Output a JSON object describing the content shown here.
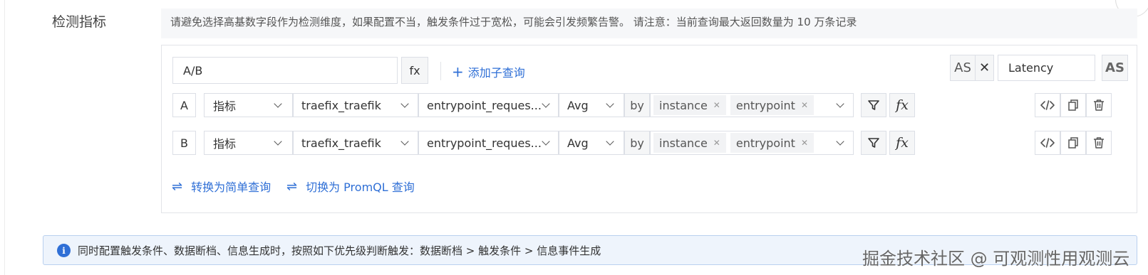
{
  "section": {
    "label": "检测指标",
    "hint": "请避免选择高基数字段作为检测维度，如果配置不当，触发条件过于宽松，可能会引发频繁告警。 请注意：当前查询最大返回数量为 10 万条记录"
  },
  "expression": {
    "value": "A/B",
    "fx_label": "fx",
    "add_subquery_label": "添加子查询",
    "as_label": "AS",
    "alias_value": "Latency",
    "as_right_label": "AS"
  },
  "queries": [
    {
      "letter": "A",
      "type": "指标",
      "measurement": "traefix_traefik",
      "metric": "entrypoint_reques...",
      "aggregation": "Avg",
      "by_label": "by",
      "group_tags": [
        "instance",
        "entrypoint"
      ],
      "fx_label": "fx"
    },
    {
      "letter": "B",
      "type": "指标",
      "measurement": "traefix_traefik",
      "metric": "entrypoint_reques...",
      "aggregation": "Avg",
      "by_label": "by",
      "group_tags": [
        "instance",
        "entrypoint"
      ],
      "fx_label": "fx"
    }
  ],
  "links": {
    "simple_query": "转换为简单查询",
    "promql_query": "切换为 PromQL 查询"
  },
  "info": {
    "icon": "info-icon",
    "text": "同时配置触发条件、数据断档、信息生成时，按照如下优先级判断触发：数据断档 > 触发条件 > 信息事件生成"
  },
  "watermark": "掘金技术社区 @ 可观测性用观测云",
  "colors": {
    "accent": "#2f6fd6",
    "info_bg": "#eef4fc",
    "info_border": "#b9d0ef"
  }
}
